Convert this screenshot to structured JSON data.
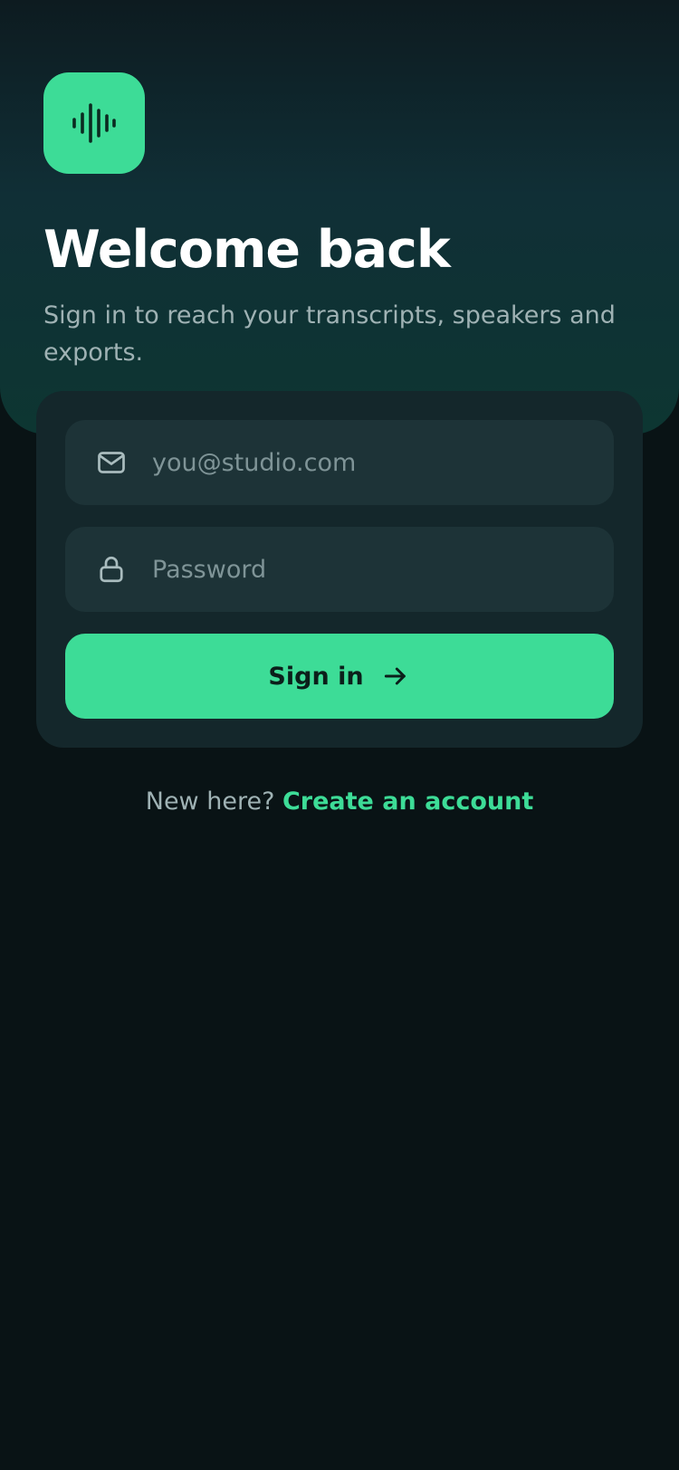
{
  "hero": {
    "logo_icon": "waveform-icon",
    "title": "Welcome back",
    "subtitle": "Sign in to reach your transcripts, speakers and exports."
  },
  "form": {
    "email": {
      "icon": "mail-icon",
      "value": "",
      "placeholder": "you@studio.com"
    },
    "password": {
      "icon": "lock-icon",
      "value": "",
      "placeholder": "Password"
    },
    "submit": {
      "label": "Sign in",
      "icon": "arrow-right-icon"
    }
  },
  "signup": {
    "prompt": "New here?",
    "link_label": "Create an account"
  },
  "colors": {
    "background": "#091315",
    "accent": "#3ddc97",
    "card": "#14272b",
    "field": "#1d3337",
    "muted_text": "#9fb2b4"
  }
}
